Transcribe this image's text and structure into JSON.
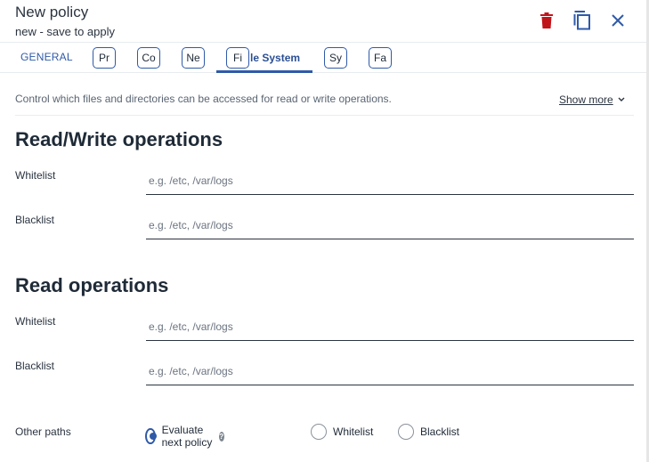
{
  "header": {
    "title": "New policy",
    "subtitle": "new - save to apply",
    "delete_icon": "trash-icon",
    "duplicate_icon": "copy-icon",
    "close_icon": "close-icon",
    "colors": {
      "delete": "#c0141b",
      "accent": "#2f5aa8"
    }
  },
  "tabs": {
    "general": "GENERAL",
    "boxed": [
      "Pr",
      "Co",
      "Ne",
      "Fi",
      "Sy",
      "Fa"
    ],
    "active_suffix": "le System"
  },
  "description": {
    "text": "Control which files and directories can be accessed for read or write operations.",
    "show_more": "Show more"
  },
  "sections": [
    {
      "title": "Read/Write operations",
      "whitelist_label": "Whitelist",
      "whitelist_placeholder": "e.g. /etc, /var/logs",
      "blacklist_label": "Blacklist",
      "blacklist_placeholder": "e.g. /etc, /var/logs"
    },
    {
      "title": "Read operations",
      "whitelist_label": "Whitelist",
      "whitelist_placeholder": "e.g. /etc, /var/logs",
      "blacklist_label": "Blacklist",
      "blacklist_placeholder": "e.g. /etc, /var/logs"
    }
  ],
  "other_paths": {
    "label": "Other paths",
    "options": [
      "Evaluate next policy",
      "Whitelist",
      "Blacklist"
    ],
    "selected": "Evaluate next policy",
    "help_glyph": "?"
  }
}
